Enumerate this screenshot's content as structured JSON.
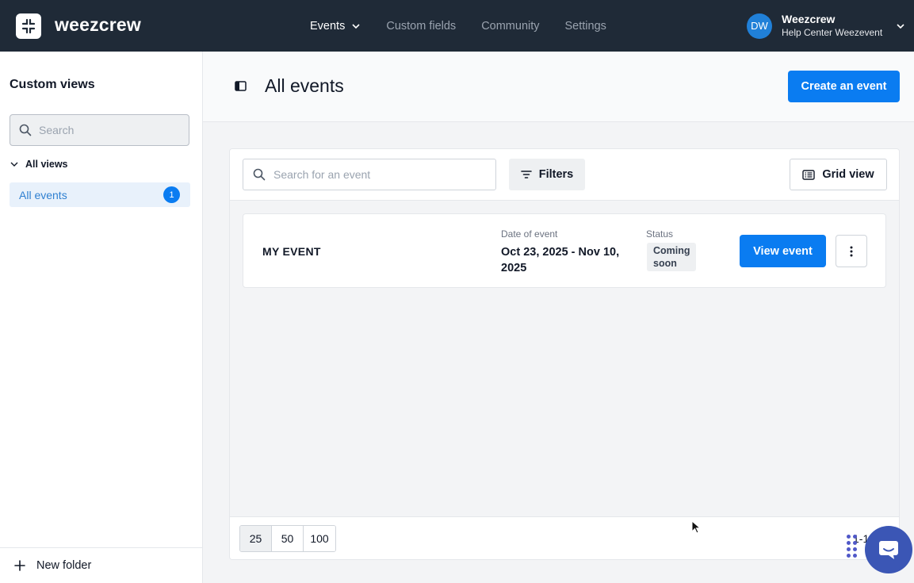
{
  "topbar": {
    "logo_text": "weezcrew",
    "nav": [
      {
        "label": "Events",
        "active": true
      },
      {
        "label": "Custom fields",
        "active": false
      },
      {
        "label": "Community",
        "active": false
      },
      {
        "label": "Settings",
        "active": false
      }
    ],
    "user": {
      "initials": "DW",
      "name": "Weezcrew",
      "subtitle": "Help Center Weezevent"
    }
  },
  "sidebar": {
    "title": "Custom views",
    "search_placeholder": "Search",
    "group_label": "All views",
    "items": [
      {
        "label": "All events",
        "count": "1",
        "selected": true
      }
    ],
    "footer_label": "New folder"
  },
  "header": {
    "title": "All events",
    "create_label": "Create an event"
  },
  "toolbar": {
    "search_placeholder": "Search for an event",
    "filters_label": "Filters",
    "grid_label": "Grid view"
  },
  "events": [
    {
      "name": "MY EVENT",
      "date_label": "Date of event",
      "date": "Oct 23, 2025 - Nov 10, 2025",
      "status_label": "Status",
      "status": "Coming soon",
      "view_label": "View event"
    }
  ],
  "pagination": {
    "page_sizes": [
      "25",
      "50",
      "100"
    ],
    "selected": "25",
    "range_text": "1-1"
  },
  "colors": {
    "topbar_bg": "#1f2a37",
    "primary": "#0a7cf1",
    "selected_bg": "#e8f1fb",
    "chat_bg": "#3b56b5"
  }
}
